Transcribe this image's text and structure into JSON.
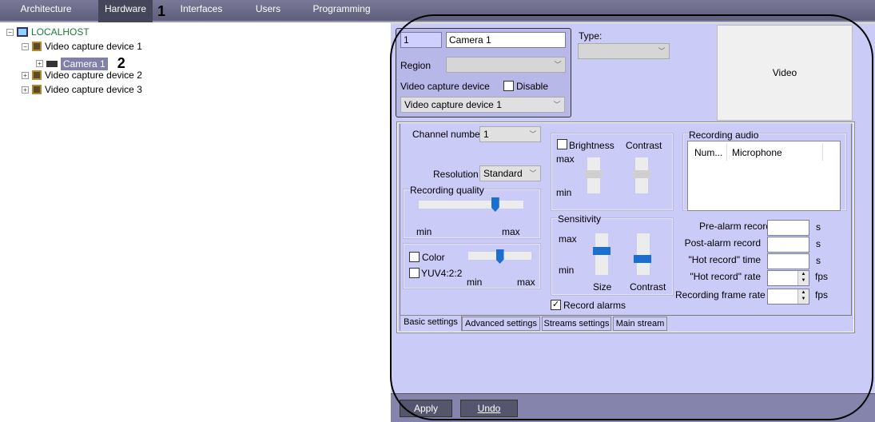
{
  "tabs": [
    {
      "label": "Architecture"
    },
    {
      "label": "Hardware"
    },
    {
      "label": "Interfaces"
    },
    {
      "label": "Users"
    },
    {
      "label": "Programming"
    }
  ],
  "annotations": {
    "one": "1",
    "two": "2"
  },
  "tree": {
    "root": "LOCALHOST",
    "device1": "Video capture device 1",
    "camera": "Camera 1",
    "device2": "Video capture device 2",
    "device3": "Video capture device 3"
  },
  "header": {
    "id": "1",
    "name": "Camera 1",
    "region_label": "Region",
    "vcd_label": "Video capture device",
    "disable_label": "Disable",
    "vcd_value": "Video capture device 1",
    "type_label": "Type:",
    "video_label": "Video"
  },
  "basic": {
    "channel_label": "Channel number",
    "channel_value": "1",
    "resolution_label": "Resolution",
    "resolution_value": "Standard",
    "quality_label": "Recording quality",
    "min": "min",
    "max": "max",
    "color_label": "Color",
    "yuv_label": "YUV4:2:2",
    "brightness_label": "Brightness",
    "contrast_label": "Contrast",
    "sensitivity_label": "Sensitivity",
    "size_label": "Size",
    "record_alarms_label": "Record alarms",
    "quality_value": 0.75,
    "color_value": 0.5,
    "size_value": 0.6,
    "sens_contrast_value": 0.35
  },
  "audio": {
    "label": "Recording audio",
    "col1": "Num...",
    "col2": "Microphone"
  },
  "records": [
    {
      "label": "Pre-alarm record",
      "unit": "s"
    },
    {
      "label": "Post-alarm record",
      "unit": "s"
    },
    {
      "label": "\"Hot record\" time",
      "unit": "s"
    },
    {
      "label": "\"Hot record\" rate",
      "unit": "fps"
    },
    {
      "label": "Recording frame rate",
      "unit": "fps"
    }
  ],
  "settings_tabs": [
    {
      "label": "Basic settings"
    },
    {
      "label": "Advanced settings"
    },
    {
      "label": "Streams settings"
    },
    {
      "label": "Main stream"
    }
  ],
  "footer": {
    "apply": "Apply",
    "undo": "Undo"
  }
}
